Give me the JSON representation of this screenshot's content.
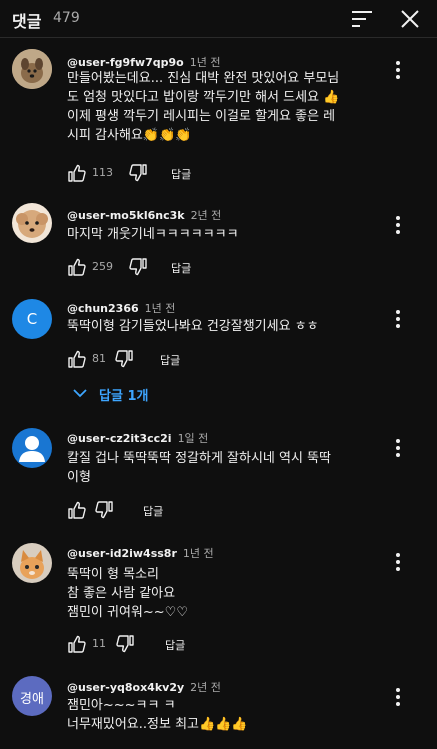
{
  "header": {
    "title": "댓글",
    "count": "479"
  },
  "comments": [
    {
      "user": "@user-fg9fw7qp9o",
      "time": "1년 전",
      "text": "만들어봤는데요... 진심 대박 완전 맛있어요 부모님\n도 엄청 맛있다고 밥이랑 깍두기만 해서 드세요 👍\n이제 평생 깍두기 레시피는 이걸로 할게요 좋은 레\n시피 감사해요👏👏👏",
      "likes": "113",
      "reply_label": "답글"
    },
    {
      "user": "@user-mo5kl6nc3k",
      "time": "2년 전",
      "text": "마지막 개웃기네ㅋㅋㅋㅋㅋㅋㅋ",
      "likes": "259",
      "reply_label": "답글"
    },
    {
      "user": "@chun2366",
      "time": "1년 전",
      "avatar_letter": "C",
      "text": "뚝딱이형 감기들었나봐요 건강잘챙기세요 ㅎㅎ",
      "likes": "81",
      "reply_label": "답글",
      "replies_label": "답글 1개"
    },
    {
      "user": "@user-cz2it3cc2i",
      "time": "1일 전",
      "text": "칼질 겁나 뚝딱뚝딱 정갈하게 잘하시네 역시 뚝딱\n이형",
      "likes": "",
      "reply_label": "답글"
    },
    {
      "user": "@user-id2iw4ss8r",
      "time": "1년 전",
      "text": "뚝딱이 형   목소리\n참  좋은 사람 같아요\n잼민이 귀여워~~♡♡",
      "likes": "11",
      "reply_label": "답글"
    },
    {
      "user": "@user-yq8ox4kv2y",
      "time": "2년 전",
      "avatar_text": "경애",
      "text": "잼민아~~~ㅋㅋ ㅋ\n너무재밌어요..정보 최고👍👍👍"
    }
  ],
  "colors": {
    "background": "#0f0f0f",
    "text_primary": "#f1f1f1",
    "text_secondary": "#aaaaaa",
    "link_blue": "#3ea6ff",
    "avatar_c": "#1e88e5",
    "avatar_person": "#1976d2",
    "avatar_gyeongae": "#5c6bc0"
  }
}
